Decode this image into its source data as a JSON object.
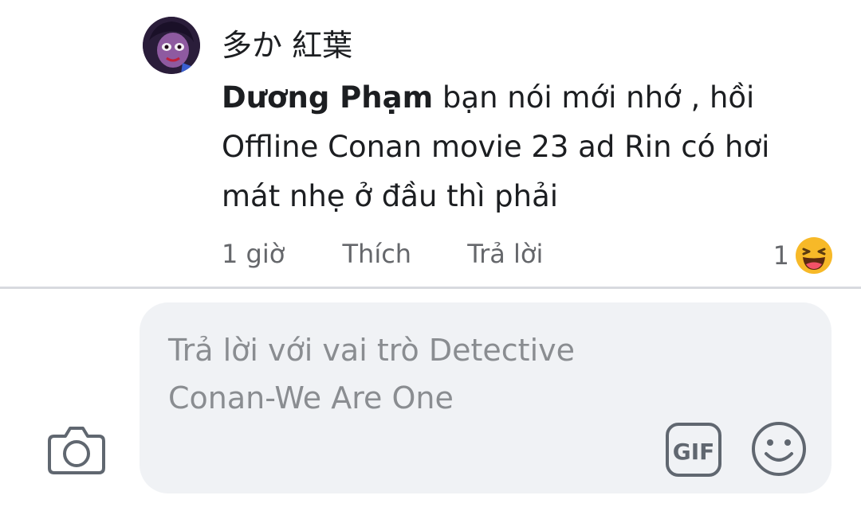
{
  "comment": {
    "author": "多か 紅葉",
    "mention": "Dương Phạm",
    "text": " bạn nói mới nhớ , hồi Offline Conan movie 23 ad Rin có hơi mát nhẹ ở đầu thì phải",
    "time": "1 giờ",
    "like_label": "Thích",
    "reply_label": "Trả lời",
    "reaction_count": "1",
    "reaction_icon": "haha-emoji-icon"
  },
  "composer": {
    "placeholder": "Trả lời với vai trò Detective Conan-We Are One",
    "camera_icon": "camera-icon",
    "gif_label": "GIF",
    "emoji_icon": "smile-icon"
  },
  "colors": {
    "text": "#1c1e21",
    "secondary": "#65676b",
    "composer_bg": "#f0f2f5",
    "placeholder": "#8a8d91",
    "haha_yellow": "#f7b928"
  }
}
